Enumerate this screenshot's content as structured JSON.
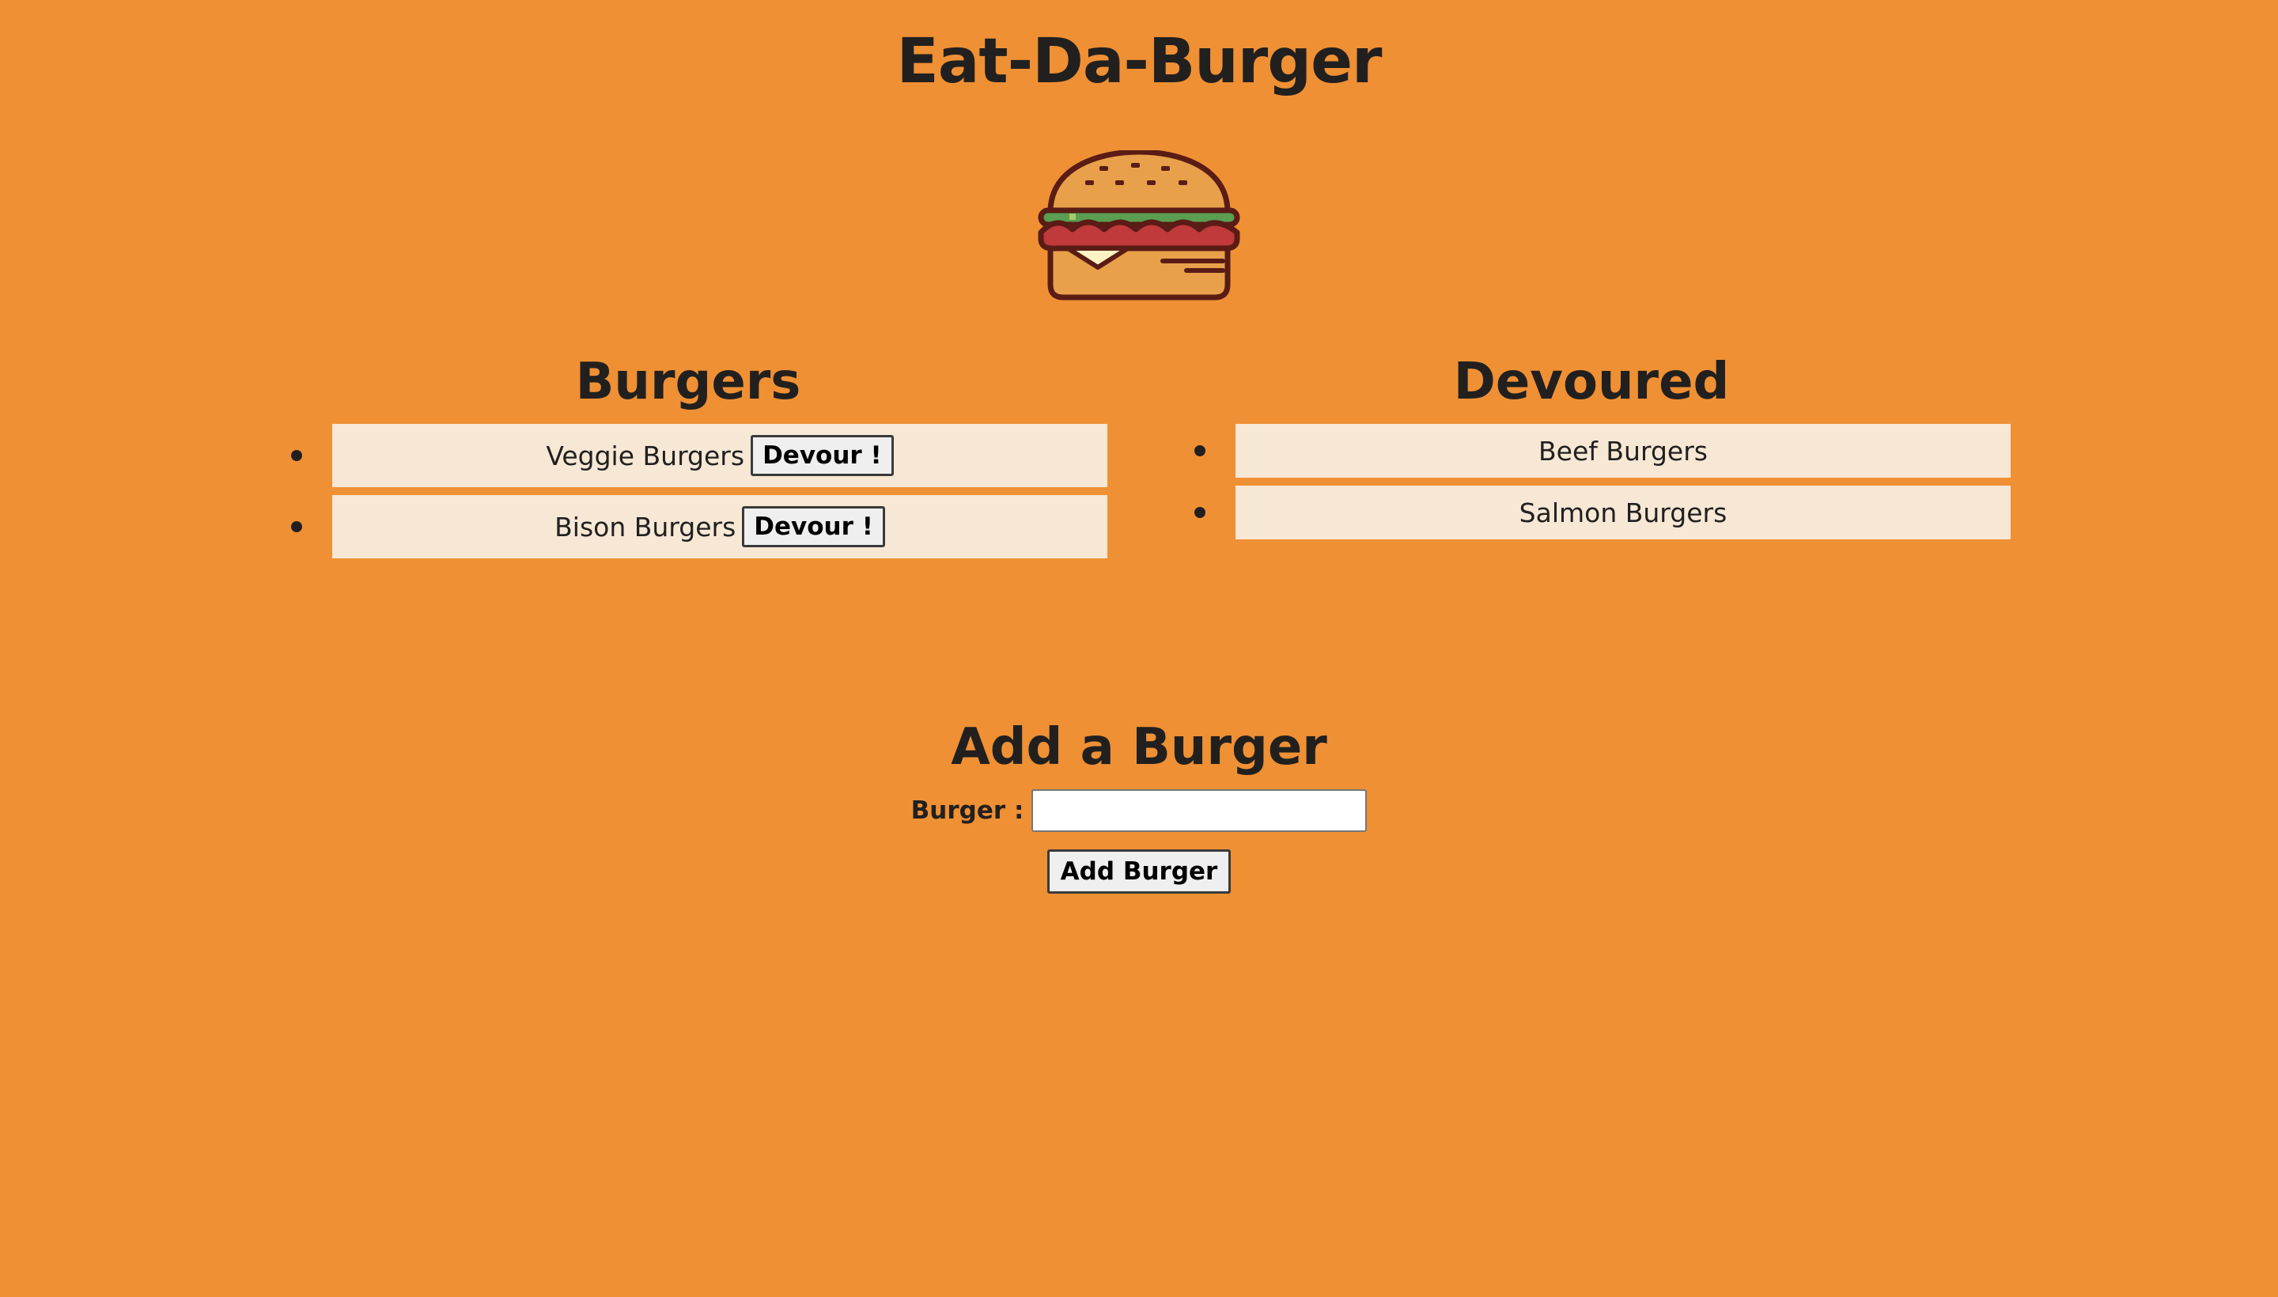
{
  "page": {
    "title": "Eat-Da-Burger",
    "logo_icon": "hamburger-icon"
  },
  "burgers": {
    "title": "Burgers",
    "items": [
      {
        "name": "Veggie Burgers",
        "button_label": "Devour !"
      },
      {
        "name": "Bison Burgers",
        "button_label": "Devour !"
      }
    ]
  },
  "devoured": {
    "title": "Devoured",
    "items": [
      {
        "name": "Beef Burgers"
      },
      {
        "name": "Salmon Burgers"
      }
    ]
  },
  "add_form": {
    "title": "Add a Burger",
    "label": "Burger :",
    "input_value": "",
    "submit_label": "Add Burger"
  },
  "colors": {
    "background": "#ef9034",
    "list_item_bg": "#f7e8d6",
    "text": "#22201f",
    "bun": "#e9a04a",
    "lettuce": "#5a9e52",
    "patty": "#c0393b",
    "cheese": "#fff2c4",
    "outline": "#5a1c14"
  }
}
